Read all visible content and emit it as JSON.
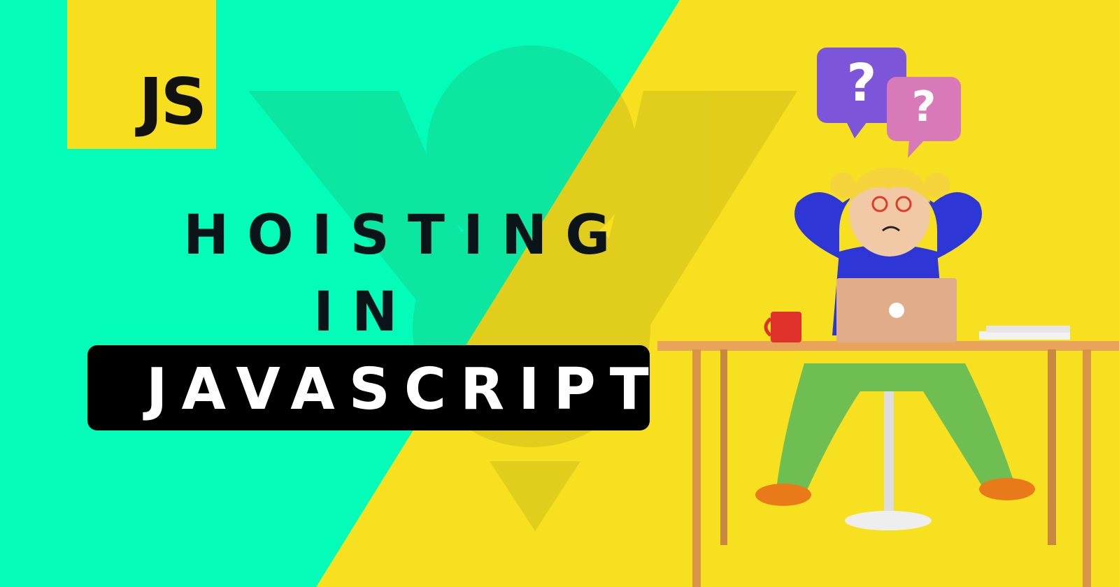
{
  "logo": {
    "text": "JS"
  },
  "title": {
    "line1": "HOISTING",
    "line2": "IN",
    "line3": "JAVASCRIPT"
  },
  "bubbles": {
    "big": "?",
    "small": "?"
  },
  "colors": {
    "green": "#03fdb9",
    "yellow": "#f7e01f",
    "badge": "#000000",
    "title_text": "#0b1418"
  }
}
